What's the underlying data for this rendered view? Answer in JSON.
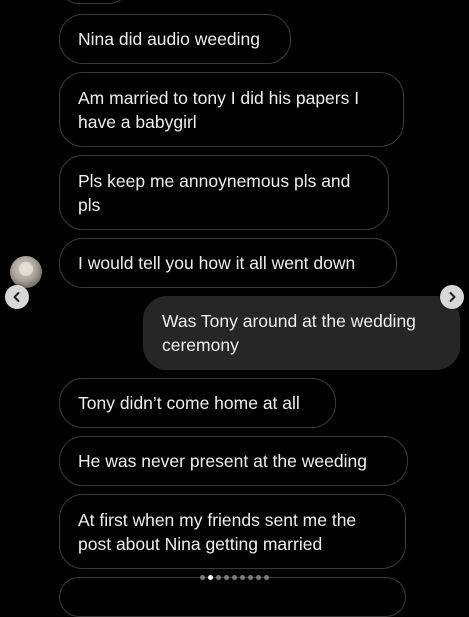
{
  "messages": [
    {
      "text": "",
      "from": "them"
    },
    {
      "text": "Nina did audio weeding",
      "from": "them"
    },
    {
      "text": "Am married to tony I did his papers I\nhave a babygirl",
      "from": "them"
    },
    {
      "text": "Pls keep me annoynemous pls and\npls",
      "from": "them"
    },
    {
      "text": "I would tell you how it all went down",
      "from": "them"
    },
    {
      "text": "Was Tony around at the wedding\nceremony",
      "from": "me"
    },
    {
      "text": "Tony didn’t come home at all",
      "from": "them"
    },
    {
      "text": "He was never present at the weeding",
      "from": "them"
    },
    {
      "text": "At first when my friends sent me the\npost about Nina getting married",
      "from": "them"
    },
    {
      "text": "",
      "from": "them"
    }
  ],
  "carousel": {
    "total_slides": 9,
    "active_slide": 2,
    "prev_icon": "chevron-left-icon",
    "next_icon": "chevron-right-icon"
  },
  "colors": {
    "background": "#000000",
    "received_border": "#3a3a3a",
    "sent_bubble": "#262626",
    "text": "#efefef"
  }
}
